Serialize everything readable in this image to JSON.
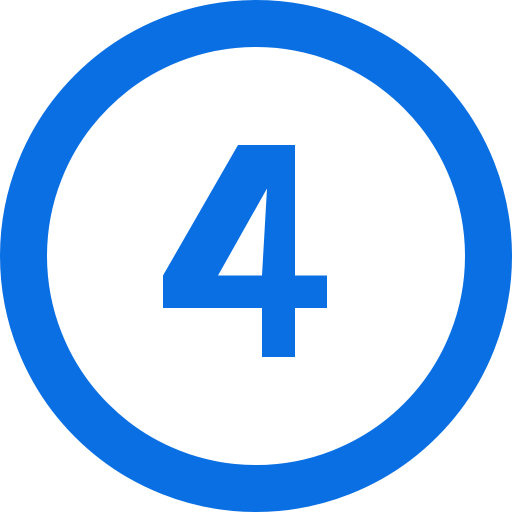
{
  "icon": {
    "name": "circled-number-4-icon",
    "number": "4",
    "colors": {
      "stroke": "#0A6FE3",
      "background": "#FFFFFF"
    }
  }
}
